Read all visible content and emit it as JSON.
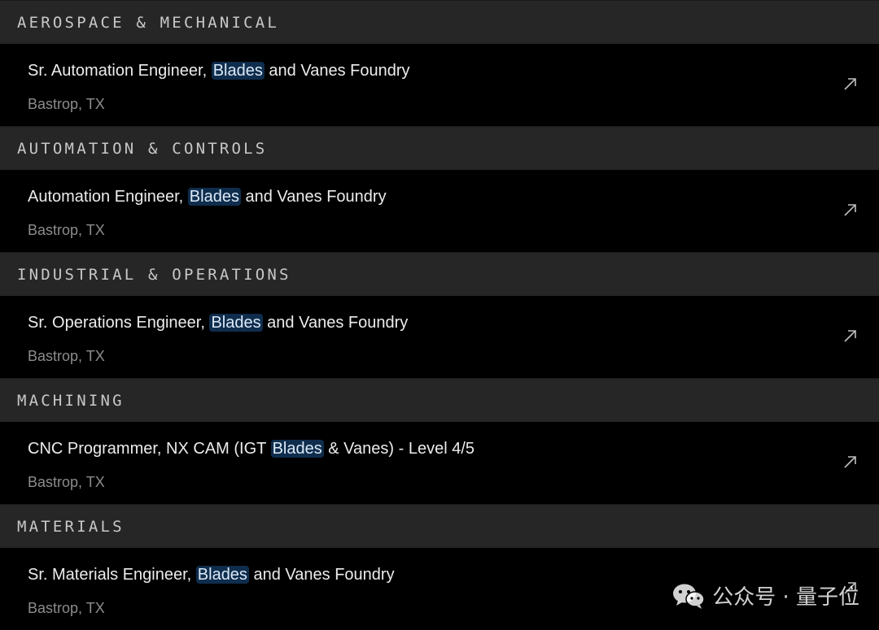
{
  "sections": [
    {
      "category": "AEROSPACE & MECHANICAL",
      "job": {
        "title_before": "Sr. Automation Engineer, ",
        "highlight": "Blades",
        "title_after": " and Vanes Foundry",
        "location": "Bastrop, TX"
      }
    },
    {
      "category": "AUTOMATION & CONTROLS",
      "job": {
        "title_before": "Automation Engineer, ",
        "highlight": "Blades",
        "title_after": " and Vanes Foundry",
        "location": "Bastrop, TX"
      }
    },
    {
      "category": "INDUSTRIAL & OPERATIONS",
      "job": {
        "title_before": "Sr. Operations Engineer, ",
        "highlight": "Blades",
        "title_after": " and Vanes Foundry",
        "location": "Bastrop, TX"
      }
    },
    {
      "category": "MACHINING",
      "job": {
        "title_before": "CNC Programmer, NX CAM (IGT ",
        "highlight": "Blades",
        "title_after": " & Vanes) - Level 4/5",
        "location": "Bastrop, TX"
      }
    },
    {
      "category": "MATERIALS",
      "job": {
        "title_before": "Sr. Materials Engineer, ",
        "highlight": "Blades",
        "title_after": " and Vanes Foundry",
        "location": "Bastrop, TX"
      }
    }
  ],
  "icons": {
    "job_link": "arrow-up-right-icon",
    "watermark": "wechat-icon"
  },
  "colors": {
    "background": "#000000",
    "category_bar": "#262626",
    "highlight_bg": "#0f2d4d"
  },
  "watermark": {
    "text": "公众号 · 量子位"
  }
}
